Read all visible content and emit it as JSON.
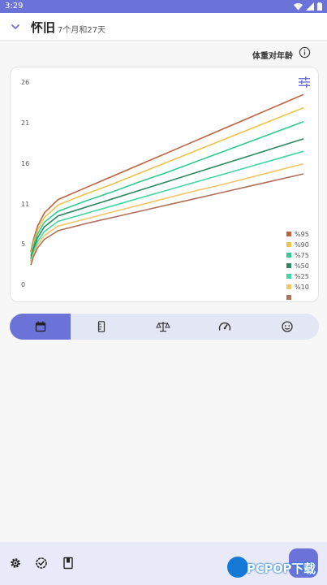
{
  "status_bar": {
    "time": "3:29"
  },
  "header": {
    "title": "怀旧",
    "subtitle": "7个月和27天"
  },
  "section": {
    "label": "体重对年龄"
  },
  "chart_data": {
    "type": "line",
    "title": "",
    "xlabel": "",
    "ylabel": "",
    "ylim": [
      0,
      26
    ],
    "yticks": [
      "26",
      "21",
      "16",
      "11",
      "5",
      "0"
    ],
    "x": [
      0,
      0.1,
      0.25,
      0.5,
      1,
      2,
      3,
      4,
      5,
      6,
      7,
      8,
      9,
      10
    ],
    "series": [
      {
        "name": "%95",
        "color": "#c0603f",
        "values": [
          4.2,
          5.8,
          7.5,
          9.2,
          10.9,
          12.4,
          13.9,
          15.4,
          16.9,
          18.4,
          19.9,
          21.4,
          22.9,
          24.4
        ]
      },
      {
        "name": "%90",
        "color": "#eec24a",
        "values": [
          3.9,
          5.4,
          7.0,
          8.6,
          10.2,
          11.6,
          12.9,
          14.3,
          15.7,
          17.1,
          18.5,
          19.9,
          21.3,
          22.7
        ]
      },
      {
        "name": "%75",
        "color": "#2ccd8f",
        "values": [
          3.6,
          5.0,
          6.5,
          8.0,
          9.4,
          10.7,
          11.9,
          13.2,
          14.4,
          15.7,
          17.0,
          18.3,
          19.6,
          20.9
        ]
      },
      {
        "name": "%50",
        "color": "#2b8a5f",
        "values": [
          3.3,
          4.6,
          6.0,
          7.4,
          8.8,
          9.9,
          11.0,
          12.1,
          13.2,
          14.3,
          15.4,
          16.5,
          17.6,
          18.7
        ]
      },
      {
        "name": "%25",
        "color": "#3fd89f",
        "values": [
          3.0,
          4.2,
          5.5,
          6.8,
          8.1,
          9.1,
          10.1,
          11.1,
          12.1,
          13.1,
          14.1,
          15.1,
          16.1,
          17.1
        ]
      },
      {
        "name": "%10",
        "color": "#f5c56a",
        "values": [
          2.8,
          3.9,
          5.1,
          6.3,
          7.5,
          8.4,
          9.3,
          10.2,
          11.1,
          12.0,
          12.8,
          13.7,
          14.6,
          15.5
        ]
      },
      {
        "name": "",
        "color": "#b0705a",
        "values": [
          2.5,
          3.6,
          4.7,
          5.8,
          6.9,
          7.8,
          8.6,
          9.4,
          10.2,
          11.0,
          11.8,
          12.6,
          13.4,
          14.2
        ]
      }
    ],
    "legend_position": "bottom-right"
  },
  "colors": {
    "accent": "#6b73d8",
    "tab_bg": "#e3e6f3",
    "bottom_bar": "#e9eaf7"
  },
  "tabs": [
    {
      "icon": "calendar-icon",
      "active": true
    },
    {
      "icon": "ruler-icon",
      "active": false
    },
    {
      "icon": "scale-icon",
      "active": false
    },
    {
      "icon": "speedometer-icon",
      "active": false
    },
    {
      "icon": "face-icon",
      "active": false
    }
  ],
  "bottom_bar": {
    "icons": [
      "gear-icon",
      "check-badge-icon",
      "book-icon"
    ]
  },
  "watermark": {
    "text": "PCPOP下载"
  }
}
